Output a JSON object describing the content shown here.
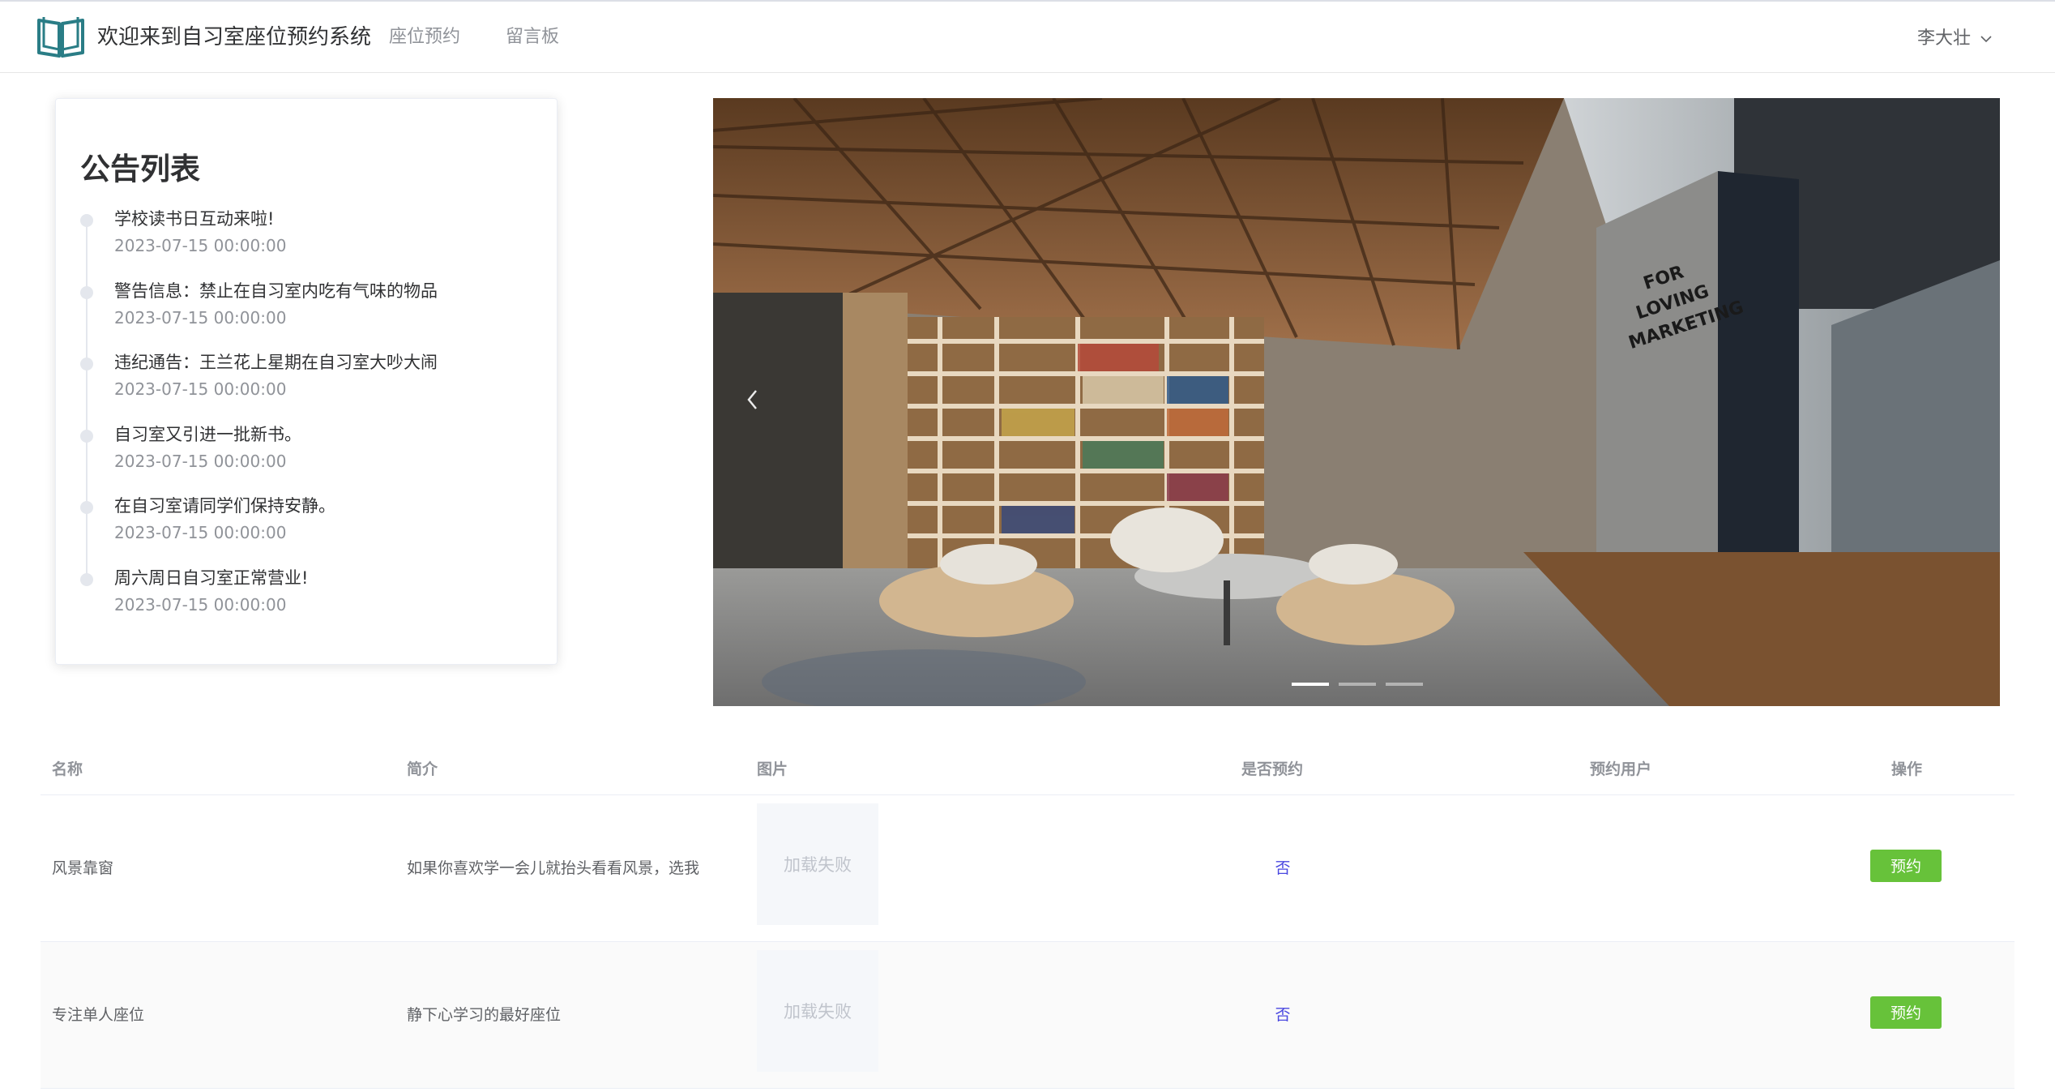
{
  "header": {
    "title": "欢迎来到自习室座位预约系统",
    "nav": [
      "座位预约",
      "留言板"
    ],
    "user_name": "李大壮",
    "logo_icon": "open-book-icon",
    "accent_color": "#2a7d86"
  },
  "notices": {
    "title": "公告列表",
    "items": [
      {
        "content": "学校读书日互动来啦!",
        "time": "2023-07-15 00:00:00"
      },
      {
        "content": "警告信息：禁止在自习室内吃有气味的物品",
        "time": "2023-07-15 00:00:00"
      },
      {
        "content": "违纪通告：王兰花上星期在自习室大吵大闹",
        "time": "2023-07-15 00:00:00"
      },
      {
        "content": "自习室又引进一批新书。",
        "time": "2023-07-15 00:00:00"
      },
      {
        "content": "在自习室请同学们保持安静。",
        "time": "2023-07-15 00:00:00"
      },
      {
        "content": "周六周日自习室正常营业!",
        "time": "2023-07-15 00:00:00"
      }
    ]
  },
  "carousel": {
    "prev_icon": "chevron-left-icon",
    "wall_text": [
      "FOR",
      "LOVING",
      "MARKETING"
    ]
  },
  "table": {
    "headers": [
      "名称",
      "简介",
      "图片",
      "是否预约",
      "预约用户",
      "操作"
    ],
    "rows": [
      {
        "name": "风景靠窗",
        "desc": "如果你喜欢学一会儿就抬头看看风景，选我",
        "image": "加载失败",
        "reserved": "否",
        "user": "",
        "action": "预约"
      },
      {
        "name": "专注单人座位",
        "desc": "静下心学习的最好座位",
        "image": "加载失败",
        "reserved": "否",
        "user": "",
        "action": "预约"
      }
    ],
    "button_color": "#67c23a"
  }
}
